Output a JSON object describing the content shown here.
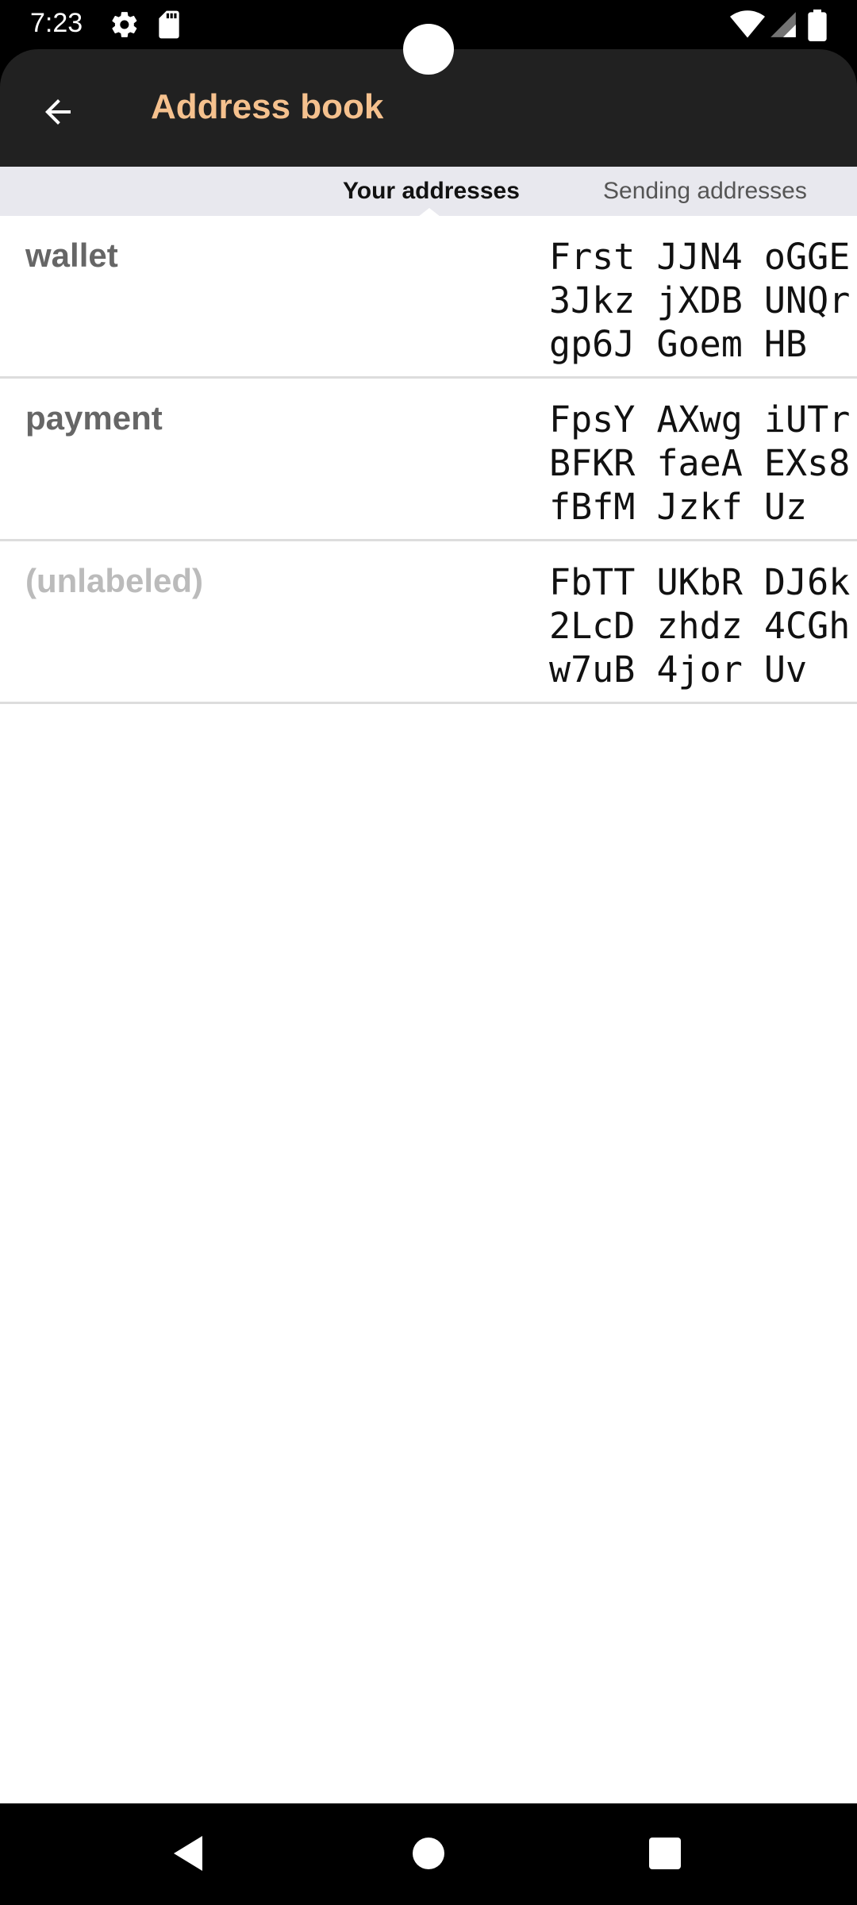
{
  "status_bar": {
    "time": "7:23",
    "left_icons": [
      "gear-icon",
      "sd-card-icon"
    ],
    "right_icons": [
      "wifi-icon",
      "signal-icon",
      "battery-icon"
    ]
  },
  "app_bar": {
    "title": "Address book",
    "back_icon": "arrow-left-icon",
    "title_color": "#F5C18E",
    "background": "#212121"
  },
  "tabs": [
    {
      "label": "Your addresses",
      "active": true
    },
    {
      "label": "Sending addresses",
      "active": false
    }
  ],
  "addresses": [
    {
      "label": "wallet",
      "address_lines": [
        "Frst JJN4 oGGE",
        "3Jkz jXDB UNQr",
        "gp6J Goem HB"
      ]
    },
    {
      "label": "payment",
      "address_lines": [
        "FpsY AXwg iUTr",
        "BFKR faeA EXs8",
        "fBfM Jzkf Uz"
      ]
    },
    {
      "label": "(unlabeled)",
      "address_lines": [
        "FbTT UKbR DJ6k",
        "2LcD zhdz 4CGh",
        "w7uB 4jor Uv"
      ]
    }
  ],
  "nav_bar": {
    "icons": [
      "back-triangle-icon",
      "home-circle-icon",
      "recents-square-icon"
    ]
  }
}
